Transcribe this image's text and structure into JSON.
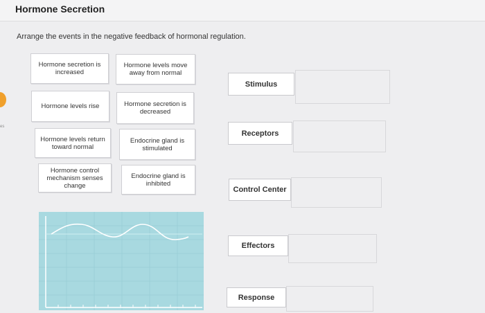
{
  "header": {
    "title": "Hormone Secretion"
  },
  "question": {
    "instruction": "Arrange the events in the negative feedback of hormonal regulation."
  },
  "side_fragment": "es",
  "cards": [
    {
      "label": "Hormone secretion is increased"
    },
    {
      "label": "Hormone levels move away from normal"
    },
    {
      "label": "Hormone levels rise"
    },
    {
      "label": "Hormone secretion is decreased"
    },
    {
      "label": "Hormone levels return toward normal"
    },
    {
      "label": "Endocrine gland is stimulated"
    },
    {
      "label": "Hormone control mechanism senses change"
    },
    {
      "label": "Endocrine gland is inhibited"
    }
  ],
  "categories": [
    {
      "label": "Stimulus"
    },
    {
      "label": "Receptors"
    },
    {
      "label": "Control Center"
    },
    {
      "label": "Effectors"
    },
    {
      "label": "Response"
    }
  ],
  "colors": {
    "graph_background": "#a8d9e0",
    "wave_line": "#ffffff",
    "side_indicator": "#f0a02c"
  }
}
